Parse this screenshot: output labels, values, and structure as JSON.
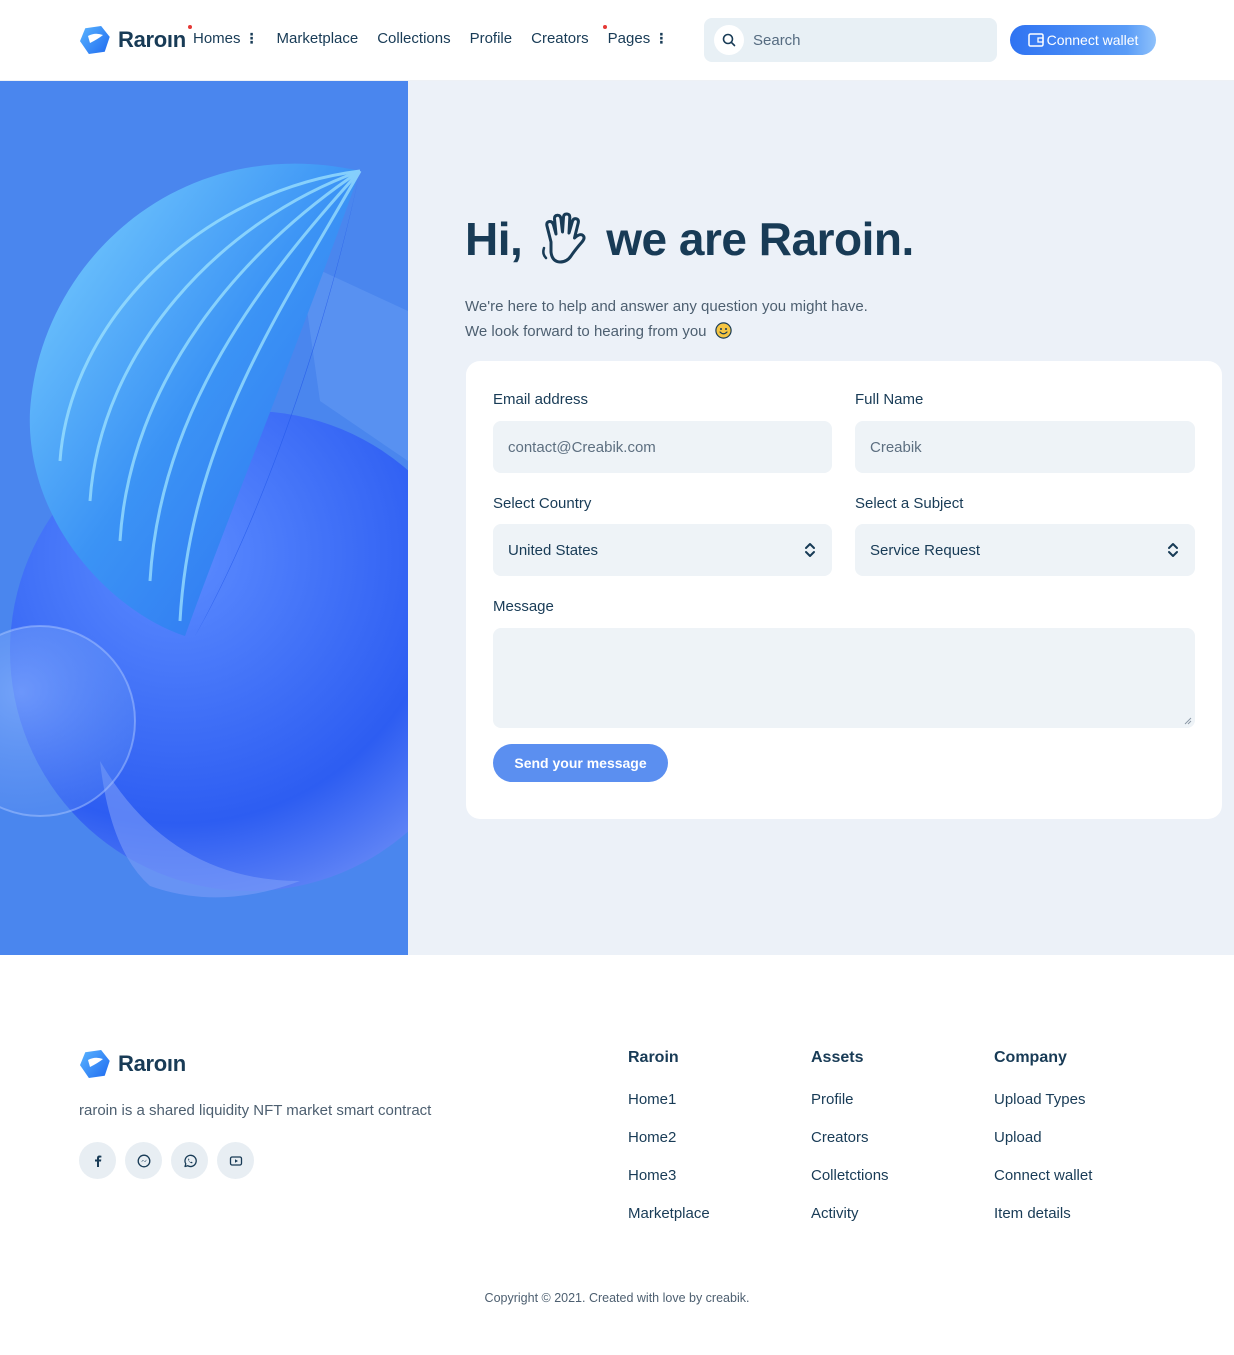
{
  "header": {
    "brand": "Raroın",
    "nav": [
      {
        "label": "Homes",
        "has_menu": true,
        "has_dot": true
      },
      {
        "label": "Marketplace",
        "has_menu": false,
        "has_dot": false
      },
      {
        "label": "Collections",
        "has_menu": false,
        "has_dot": false
      },
      {
        "label": "Profile",
        "has_menu": false,
        "has_dot": false
      },
      {
        "label": "Creators",
        "has_menu": false,
        "has_dot": false
      },
      {
        "label": "Pages",
        "has_menu": true,
        "has_dot": true
      }
    ],
    "search_placeholder": "Search",
    "connect_label": "Connect wallet"
  },
  "hero": {
    "title_before": "Hi,",
    "title_after": "we are Raroin.",
    "subtitle_line1": "We're here to help and answer any question you might have.",
    "subtitle_line2": "We look forward to hearing from you"
  },
  "form": {
    "email_label": "Email address",
    "email_placeholder": "contact@Creabik.com",
    "name_label": "Full Name",
    "name_placeholder": "Creabik",
    "country_label": "Select Country",
    "country_value": "United States",
    "subject_label": "Select a Subject",
    "subject_value": "Service Request",
    "message_label": "Message",
    "send_label": "Send your message"
  },
  "footer": {
    "brand": "Raroın",
    "tagline": "raroin is a shared liquidity NFT market smart contract",
    "socials": [
      "facebook-icon",
      "messenger-icon",
      "whatsapp-icon",
      "youtube-icon"
    ],
    "columns": [
      {
        "title": "Raroin",
        "links": [
          "Home1",
          "Home2",
          "Home3",
          "Marketplace"
        ]
      },
      {
        "title": "Assets",
        "links": [
          "Profile",
          "Creators",
          "Colletctions",
          "Activity"
        ]
      },
      {
        "title": "Company",
        "links": [
          "Upload Types",
          "Upload",
          "Connect wallet",
          "Item details"
        ]
      }
    ],
    "copyright": "Copyright © 2021. Created with love by creabik."
  },
  "colors": {
    "accent": "#2f73f2",
    "hero_blue": "#4a86ee",
    "text_dark": "#183b56",
    "send_button": "#5b8ff0"
  }
}
